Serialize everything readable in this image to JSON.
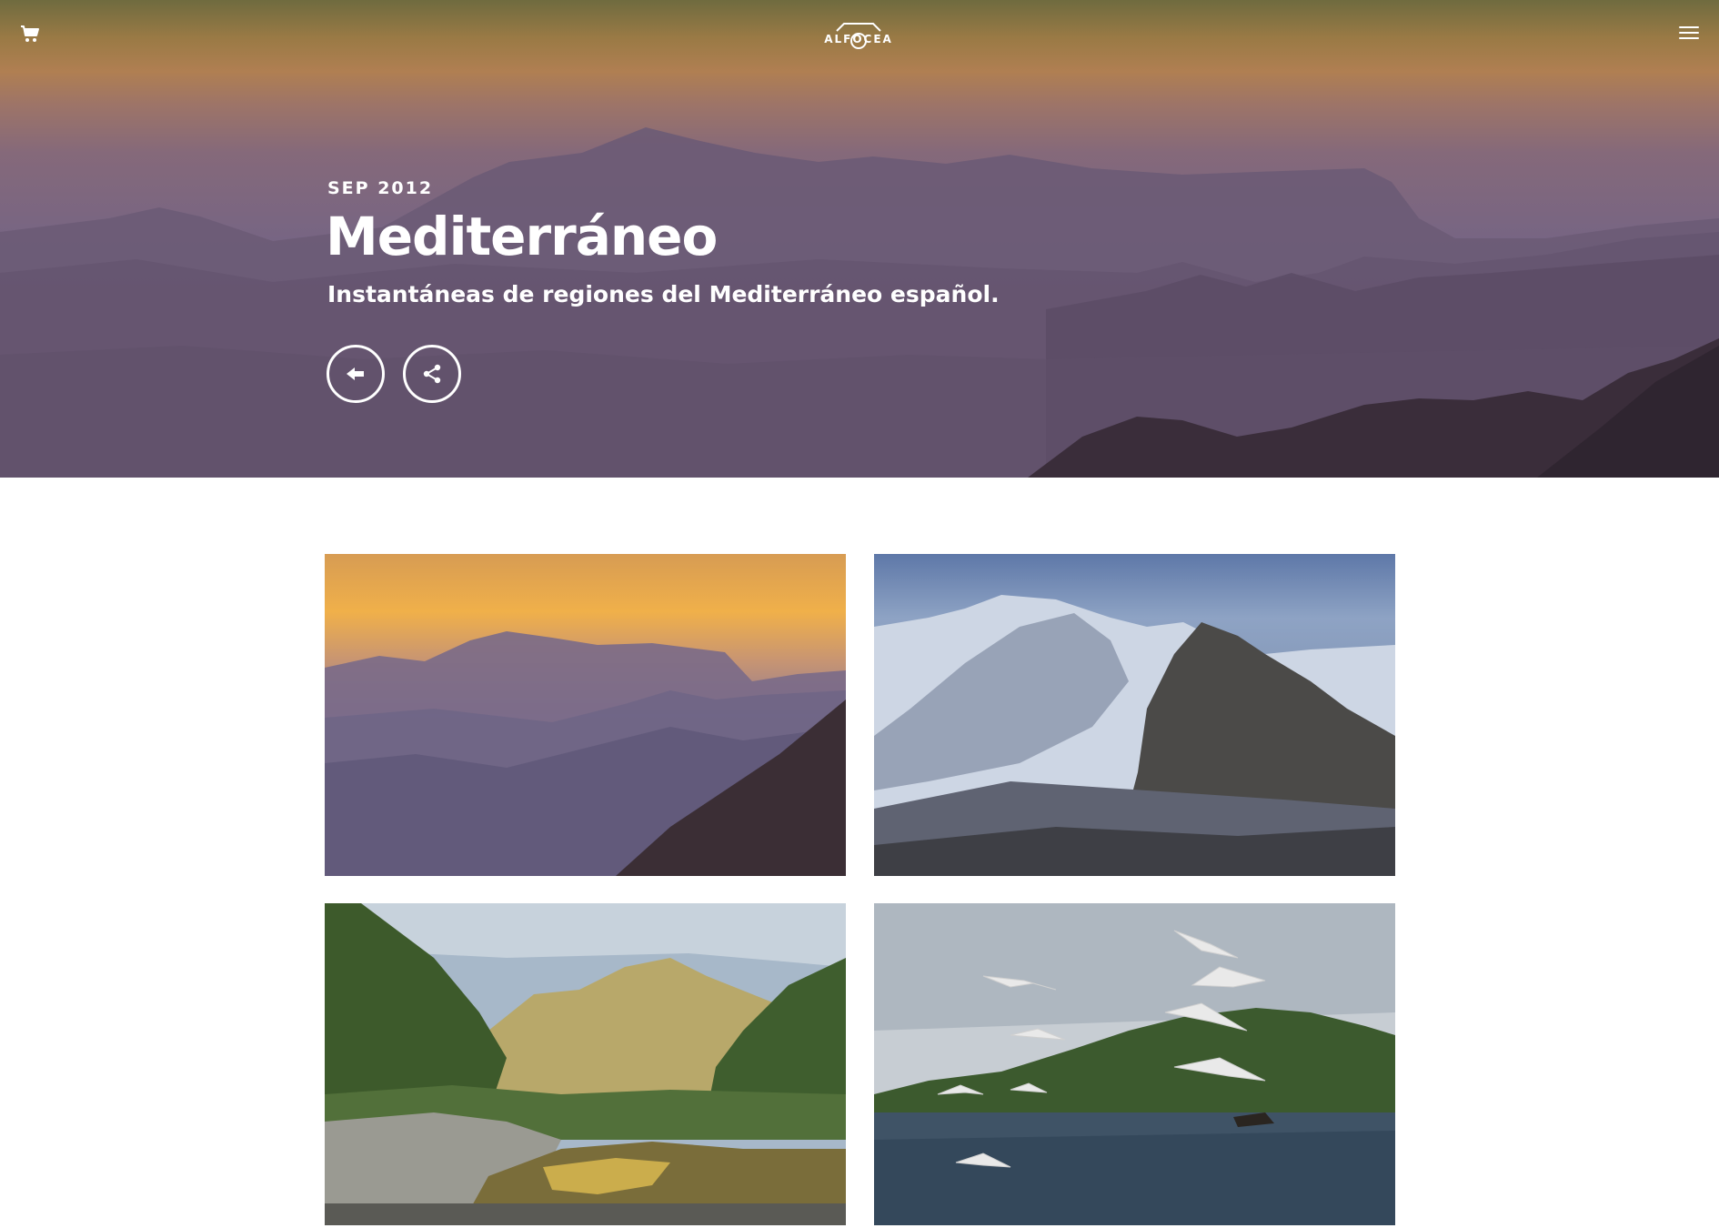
{
  "header": {
    "logo_text": "ALFOCEA",
    "icons": [
      "cart-icon",
      "menu-icon",
      "camera-logo-icon"
    ]
  },
  "hero": {
    "date": "SEP 2012",
    "title": "Mediterráneo",
    "subtitle": "Instantáneas de regiones del Mediterráneo español.",
    "buttons": [
      {
        "name": "back-button",
        "icon": "arrow-left-icon"
      },
      {
        "name": "share-button",
        "icon": "share-icon"
      }
    ]
  },
  "gallery": {
    "photos": [
      {
        "subject": "misty mountain ridges at sunset"
      },
      {
        "subject": "snow-dusted rocky mountains"
      },
      {
        "subject": "river in a green canyon"
      },
      {
        "subject": "seagulls over the sea with a boat"
      }
    ]
  },
  "colors": {
    "text": "#ffffff",
    "page_background": "#ffffff",
    "hero_sky_top": "#6f6b3f",
    "hero_sky_glow": "#b07f52",
    "hero_mountains": "#645570"
  }
}
